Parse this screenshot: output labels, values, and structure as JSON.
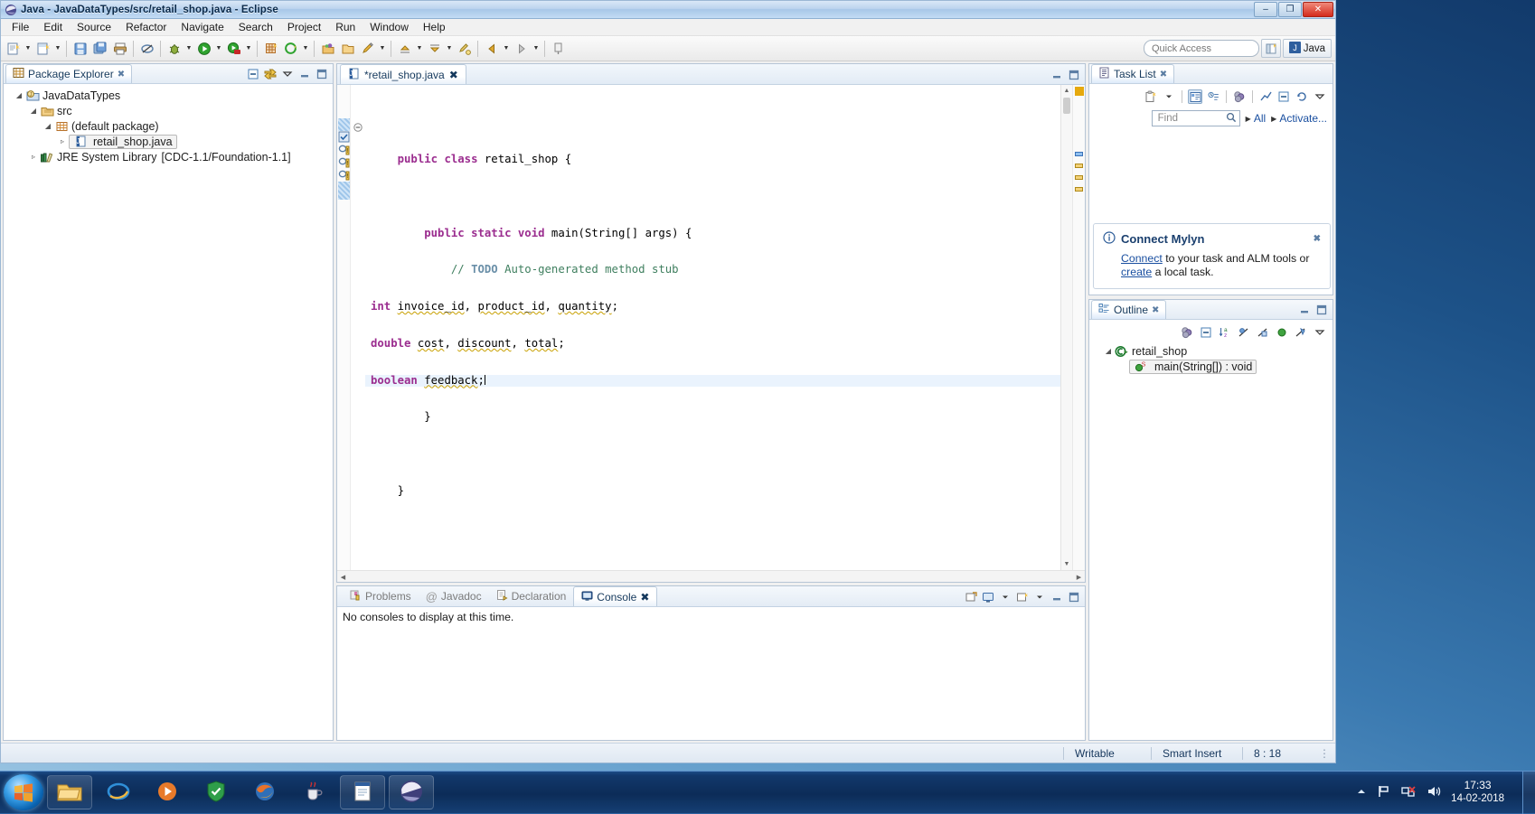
{
  "window": {
    "title": "Java - JavaDataTypes/src/retail_shop.java - Eclipse",
    "icon": "eclipse-icon",
    "minimize_label": "–",
    "maximize_label": "❐",
    "close_label": "✕"
  },
  "menubar": {
    "items": [
      {
        "label": "File"
      },
      {
        "label": "Edit"
      },
      {
        "label": "Source"
      },
      {
        "label": "Refactor"
      },
      {
        "label": "Navigate"
      },
      {
        "label": "Search"
      },
      {
        "label": "Project"
      },
      {
        "label": "Run"
      },
      {
        "label": "Window"
      },
      {
        "label": "Help"
      }
    ]
  },
  "toolbar": {
    "icons": [
      "new-wizard-icon",
      "new-java-class-icon",
      "save-icon",
      "save-all-icon",
      "print-icon",
      "toggle-markoccurrences-icon",
      "debug-icon",
      "run-icon",
      "run-coverage-icon",
      "new-java-project-icon",
      "open-type-icon",
      "open-task-icon",
      "open-resource-icon",
      "annotation-icon",
      "previous-annotation-icon",
      "next-annotation-icon",
      "last-edit-location-icon",
      "back-icon",
      "forward-icon",
      "pin-editor-icon"
    ],
    "quick_access_placeholder": "Quick Access",
    "perspective_label": "Java",
    "perspective_icon": "java-perspective-icon",
    "open-perspective-icon": "open-perspective-icon"
  },
  "package_explorer": {
    "tab_label": "Package Explorer",
    "tab_icon": "package-explorer-icon",
    "close_icon": "✖",
    "toolbar_icons": [
      "collapse-all-icon",
      "link-with-editor-icon",
      "view-menu-icon",
      "minimize-icon",
      "maximize-icon"
    ],
    "tree": [
      {
        "label": "JavaDataTypes",
        "indent": 0,
        "icon": "java-project-icon",
        "arrow": "◢",
        "suffix": ""
      },
      {
        "label": "src",
        "indent": 1,
        "icon": "source-folder-icon",
        "arrow": "◢",
        "suffix": ""
      },
      {
        "label": "(default package)",
        "indent": 2,
        "icon": "package-icon",
        "arrow": "◢",
        "suffix": ""
      },
      {
        "label": "retail_shop.java",
        "indent": 3,
        "icon": "java-file-icon",
        "arrow": "▹",
        "suffix": "",
        "selected": true
      },
      {
        "label": "JRE System Library",
        "indent": 1,
        "icon": "library-icon",
        "arrow": "▹",
        "suffix": "[CDC-1.1/Foundation-1.1]"
      }
    ]
  },
  "editor": {
    "tab_label": "*retail_shop.java",
    "tab_icon": "java-file-icon",
    "close_icon": "✖",
    "minimize_icon": "–",
    "maximize_icon": "❐",
    "fold_marker": "⊖",
    "annotations": [
      "task-todo-icon",
      "warning-icon",
      "warning-icon",
      "warning-icon"
    ],
    "lines": [
      {
        "id": 1,
        "text": "",
        "type": "blank"
      },
      {
        "id": 2,
        "text": "public class retail_shop {",
        "type": "code"
      },
      {
        "id": 3,
        "text": "",
        "type": "blank"
      },
      {
        "id": 4,
        "text": "public static void main(String[] args) {",
        "type": "code"
      },
      {
        "id": 5,
        "text": "// TODO Auto-generated method stub",
        "type": "comment"
      },
      {
        "id": 6,
        "text": "int invoice_id, product_id, quantity;",
        "type": "code"
      },
      {
        "id": 7,
        "text": "double cost, discount, total;",
        "type": "code"
      },
      {
        "id": 8,
        "text": "boolean feedback;",
        "type": "code",
        "highlighted": true
      },
      {
        "id": 9,
        "text": "}",
        "type": "code"
      },
      {
        "id": 10,
        "text": "",
        "type": "blank"
      },
      {
        "id": 11,
        "text": "}",
        "type": "code"
      }
    ]
  },
  "console_panel": {
    "tabs": [
      {
        "label": "Problems",
        "icon": "problems-icon",
        "active": false
      },
      {
        "label": "Javadoc",
        "icon": "javadoc-icon",
        "active": false
      },
      {
        "label": "Declaration",
        "icon": "declaration-icon",
        "active": false
      },
      {
        "label": "Console",
        "icon": "console-icon",
        "active": true
      }
    ],
    "close_icon": "✖",
    "message": "No consoles to display at this time.",
    "toolbar_icons": [
      "open-console-icon",
      "display-selected-console-icon",
      "dropdown-icon",
      "new-console-view-icon",
      "minimize-icon",
      "maximize-icon"
    ]
  },
  "task_list": {
    "tab_label": "Task List",
    "tab_icon": "task-list-icon",
    "close_icon": "✖",
    "toolbar_icons": [
      "new-task-icon",
      "dropdown-icon",
      "categorized-mode-icon",
      "scheduled-mode-icon",
      "synchronize-icon",
      "focus-workweek-icon",
      "collapse-all-icon",
      "restore-icon",
      "view-menu-icon",
      "minimize-icon",
      "maximize-icon"
    ],
    "find_placeholder": "Find",
    "search_icon": "search-icon",
    "filters": [
      {
        "label": "All"
      },
      {
        "label": "Activate..."
      }
    ],
    "notice": {
      "icon": "info-icon",
      "title": "Connect Mylyn",
      "link": "Connect",
      "text_after_link": " to your task and ALM tools or ",
      "link2": "create",
      "text_end": " a local task."
    }
  },
  "outline": {
    "tab_label": "Outline",
    "tab_icon": "outline-icon",
    "close_icon": "✖",
    "toolbar_icons": [
      "focus-on-active-task-icon",
      "collapse-all-icon",
      "sort-icon",
      "hide-fields-icon",
      "hide-static-icon",
      "hide-nonpublic-icon",
      "hide-local-types-icon",
      "view-menu-icon",
      "minimize-icon",
      "maximize-icon"
    ],
    "tree": [
      {
        "label": "retail_shop",
        "indent": 0,
        "icon": "class-icon",
        "arrow": "◢"
      },
      {
        "label": "main(String[]) : void",
        "indent": 1,
        "icon": "method-public-static-icon",
        "arrow": "",
        "selected": true
      }
    ]
  },
  "statusbar": {
    "writable": "Writable",
    "insert_mode": "Smart Insert",
    "position": "8 : 18",
    "resize_grip": "⋮"
  },
  "taskbar": {
    "start_label": "start-orb",
    "buttons": [
      {
        "name": "file-explorer-icon"
      },
      {
        "name": "internet-explorer-icon"
      },
      {
        "name": "media-player-icon"
      },
      {
        "name": "antivirus-shield-icon"
      },
      {
        "name": "firefox-icon"
      },
      {
        "name": "java-coffee-icon"
      },
      {
        "name": "notepad-document-icon"
      },
      {
        "name": "eclipse-icon"
      }
    ],
    "tray_icons": [
      "show-hidden-icons-icon",
      "flag-action-center-icon",
      "network-disconnected-icon",
      "volume-icon"
    ],
    "clock_time": "17:33",
    "clock_date": "14-02-2018"
  },
  "colors": {
    "accent": "#1a4fa0",
    "keyword": "#9b2d8f",
    "comment": "#3f7f5f",
    "todo": "#6a8fa8",
    "warning": "#e6a90d",
    "title_bar": "#bcd4ee"
  }
}
